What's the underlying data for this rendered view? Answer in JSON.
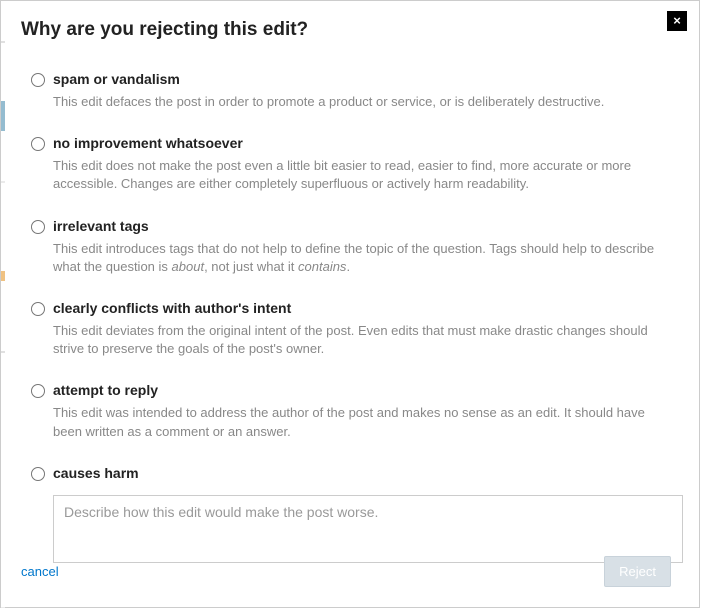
{
  "title": "Why are you rejecting this edit?",
  "options": {
    "spam": {
      "label": "spam or vandalism",
      "desc": "This edit defaces the post in order to promote a product or service, or is deliberately destructive."
    },
    "noimprove": {
      "label": "no improvement whatsoever",
      "desc": "This edit does not make the post even a little bit easier to read, easier to find, more accurate or more accessible. Changes are either completely superfluous or actively harm readability."
    },
    "tags": {
      "label": "irrelevant tags",
      "desc_a": "This edit introduces tags that do not help to define the topic of the question. Tags should help to describe what the question is ",
      "desc_about": "about",
      "desc_b": ", not just what it ",
      "desc_contains": "contains",
      "desc_c": "."
    },
    "conflict": {
      "label": "clearly conflicts with author's intent",
      "desc": "This edit deviates from the original intent of the post. Even edits that must make drastic changes should strive to preserve the goals of the post's owner."
    },
    "reply": {
      "label": "attempt to reply",
      "desc": "This edit was intended to address the author of the post and makes no sense as an edit. It should have been written as a comment or an answer."
    },
    "harm": {
      "label": "causes harm",
      "placeholder": "Describe how this edit would make the post worse."
    }
  },
  "footer": {
    "cancel": "cancel",
    "reject": "Reject"
  },
  "close_glyph": "×"
}
